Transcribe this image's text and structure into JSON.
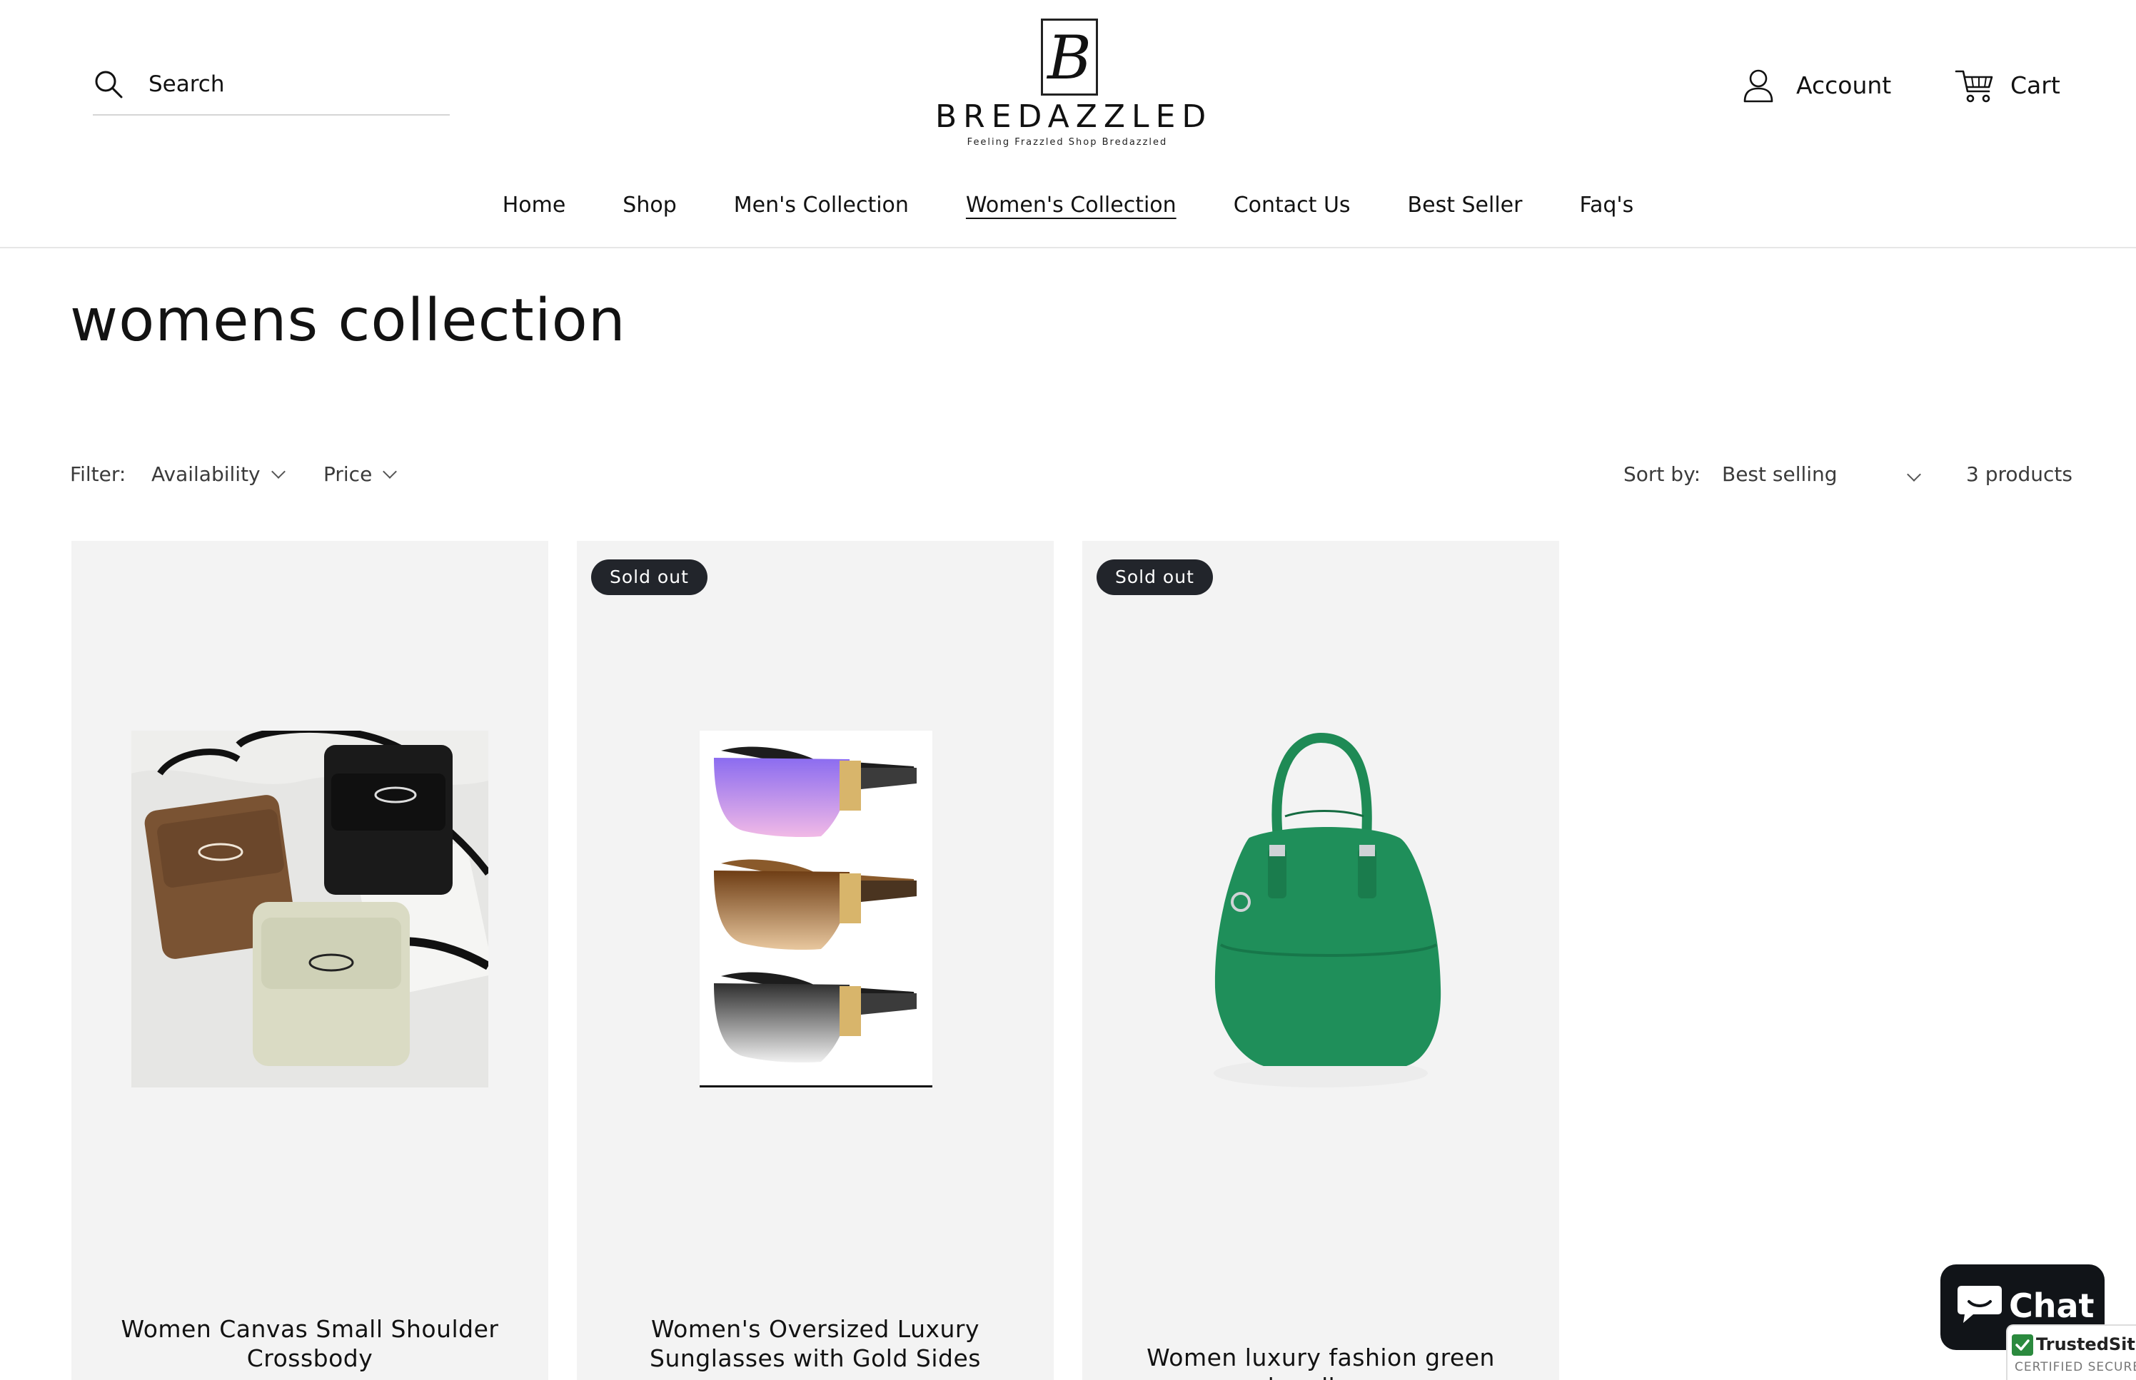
{
  "header": {
    "search_label": "Search",
    "logo": {
      "monogram": "B",
      "brand": "BREDAZZLED",
      "tagline": "Feeling Frazzled Shop Bredazzled"
    },
    "account_label": "Account",
    "cart_label": "Cart"
  },
  "nav": {
    "items": [
      "Home",
      "Shop",
      "Men's Collection",
      "Women's Collection",
      "Contact Us",
      "Best Seller",
      "Faq's"
    ],
    "active": "Women's Collection"
  },
  "page": {
    "title": "womens collection"
  },
  "filters": {
    "label": "Filter:",
    "availability": "Availability",
    "price": "Price",
    "sort_label": "Sort by:",
    "sort_value": "Best selling",
    "count": "3 products"
  },
  "products": [
    {
      "title": "Women Canvas Small Shoulder Crossbody",
      "badge": ""
    },
    {
      "title": "Women's Oversized Luxury Sunglasses with Gold Sides",
      "badge": "Sold out"
    },
    {
      "title": "Women luxury fashion green handbag",
      "badge": "Sold out"
    }
  ],
  "chat": {
    "label": "Chat"
  },
  "trust": {
    "title": "TrustedSite",
    "subtitle": "CERTIFIED SECURE"
  },
  "colors": {
    "badge_bg": "#22252b",
    "card_bg": "#f3f3f3",
    "chat_bg": "#111418",
    "handbag_green": "#1f8f5a"
  }
}
